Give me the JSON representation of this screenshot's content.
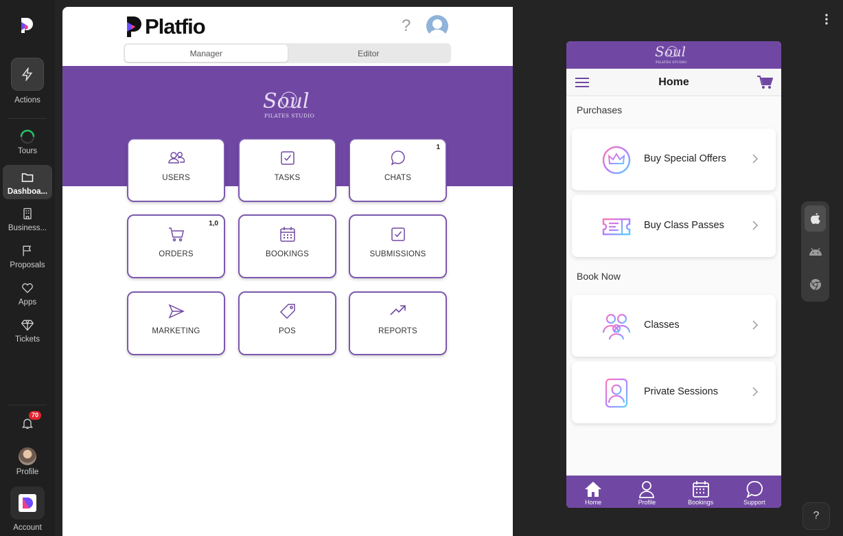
{
  "rail": {
    "items": [
      {
        "label": "Actions"
      },
      {
        "label": "Tours"
      },
      {
        "label": "Dashboa..."
      },
      {
        "label": "Business..."
      },
      {
        "label": "Proposals"
      },
      {
        "label": "Apps"
      },
      {
        "label": "Tickets"
      }
    ],
    "notifications_badge": "70",
    "profile_label": "Profile",
    "account_label": "Account"
  },
  "header": {
    "brand": "Platfio",
    "help_symbol": "?",
    "mode_tabs": [
      {
        "label": "Manager",
        "active": true
      },
      {
        "label": "Editor",
        "active": false
      }
    ]
  },
  "studio": {
    "logo_text": "Soul",
    "logo_sub": "PILATES STUDIO"
  },
  "tiles": [
    {
      "label": "USERS",
      "icon": "users-icon",
      "count": ""
    },
    {
      "label": "TASKS",
      "icon": "task-check-icon",
      "count": ""
    },
    {
      "label": "CHATS",
      "icon": "chat-bubble-icon",
      "count": "1"
    },
    {
      "label": "ORDERS",
      "icon": "cart-icon",
      "count": "1,0"
    },
    {
      "label": "BOOKINGS",
      "icon": "calendar-icon",
      "count": ""
    },
    {
      "label": "SUBMISSIONS",
      "icon": "submission-check-icon",
      "count": ""
    },
    {
      "label": "MARKETING",
      "icon": "send-icon",
      "count": ""
    },
    {
      "label": "POS",
      "icon": "tag-icon",
      "count": ""
    },
    {
      "label": "REPORTS",
      "icon": "trend-up-icon",
      "count": ""
    }
  ],
  "phone": {
    "title": "Home",
    "sections": [
      {
        "heading": "Purchases",
        "cards": [
          {
            "label": "Buy Special Offers",
            "icon": "crown-icon"
          },
          {
            "label": "Buy Class Passes",
            "icon": "ticket-icon"
          }
        ]
      },
      {
        "heading": "Book Now",
        "cards": [
          {
            "label": "Classes",
            "icon": "group-icon"
          },
          {
            "label": "Private Sessions",
            "icon": "person-badge-icon"
          }
        ]
      }
    ],
    "tabs": [
      {
        "label": "Home",
        "icon": "home-icon"
      },
      {
        "label": "Profile",
        "icon": "profile-icon"
      },
      {
        "label": "Bookings",
        "icon": "calendar-icon"
      },
      {
        "label": "Support",
        "icon": "chat-bubble-icon"
      }
    ]
  },
  "platforms": [
    {
      "name": "ios",
      "icon": "apple-icon",
      "active": true
    },
    {
      "name": "android",
      "icon": "android-icon",
      "active": false
    },
    {
      "name": "web",
      "icon": "chrome-icon",
      "active": false
    }
  ],
  "help_button": "?",
  "colors": {
    "brand_purple": "#7048a3",
    "tile_border": "#7b58ae",
    "badge_red": "#e0242e"
  }
}
